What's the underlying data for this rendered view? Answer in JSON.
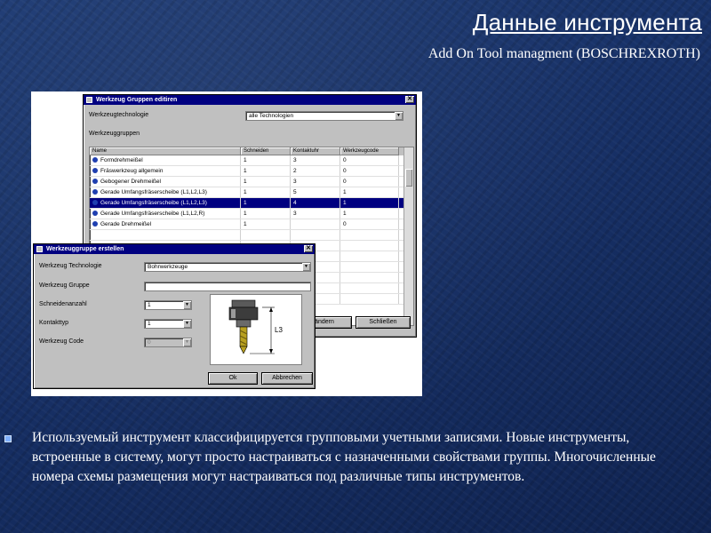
{
  "slide": {
    "title": "Данные инструмента",
    "subtitle": "Add On Tool managment  (BOSCHREXROTH)",
    "bullet_text": "Используемый инструмент классифицируется групповыми учетными записями. Новые инструменты, встроенные в систему, могут просто настраиваться с назначенными свойствами группы. Многочисленные номера схемы размещения могут настраиваться под различные типы инструментов."
  },
  "dialog_groups": {
    "title": "Werkzeug Gruppen editiren",
    "tech_label": "Werkzeugtechnologie",
    "tech_value": "alle Technologien",
    "groups_label": "Werkzeuggruppen",
    "columns": [
      "Name",
      "Schneiden",
      "Kontaktuhr",
      "Werkzeugcode"
    ],
    "rows": [
      {
        "name": "Formdrehmeißel",
        "c1": "1",
        "c2": "3",
        "c3": "0"
      },
      {
        "name": "Fräswerkzeug allgemein",
        "c1": "1",
        "c2": "2",
        "c3": "0"
      },
      {
        "name": "Gebogener Drehmeißel",
        "c1": "1",
        "c2": "3",
        "c3": "0"
      },
      {
        "name": "Gerade Umfangsfräserscheibe (L1,L2,L3)",
        "c1": "1",
        "c2": "5",
        "c3": "1"
      },
      {
        "name": "Gerade Umfangsfräserscheibe (L1,L2,L3)",
        "c1": "1",
        "c2": "4",
        "c3": "1"
      },
      {
        "name": "Gerade Umfangsfräserscheibe (L1,L2,R)",
        "c1": "1",
        "c2": "3",
        "c3": "1"
      },
      {
        "name": "Gerade Drehmeißel",
        "c1": "1",
        "c2": "",
        "c3": "0"
      }
    ],
    "selected_index": 4,
    "button_edit": "ändern",
    "button_close": "Schließen"
  },
  "dialog_new": {
    "title": "Werkzeuggruppe erstellen",
    "tech_label": "Werkzeug Technologie",
    "tech_value": "Bohrwerkzeuge",
    "group_label": "Werkzeug Gruppe",
    "cutters_label": "Schneidenanzahl",
    "cutters_value": "1",
    "contact_label": "Kontakttyp",
    "contact_value": "1",
    "code_label": "Werkzeug Code",
    "code_value": "0",
    "dimension_label": "L3",
    "button_ok": "Ok",
    "button_cancel": "Abbrechen"
  },
  "colors": {
    "title_bar": "#000080",
    "selection": "#000080",
    "dialog_face": "#c0c0c0",
    "slide_background": "#173066"
  }
}
